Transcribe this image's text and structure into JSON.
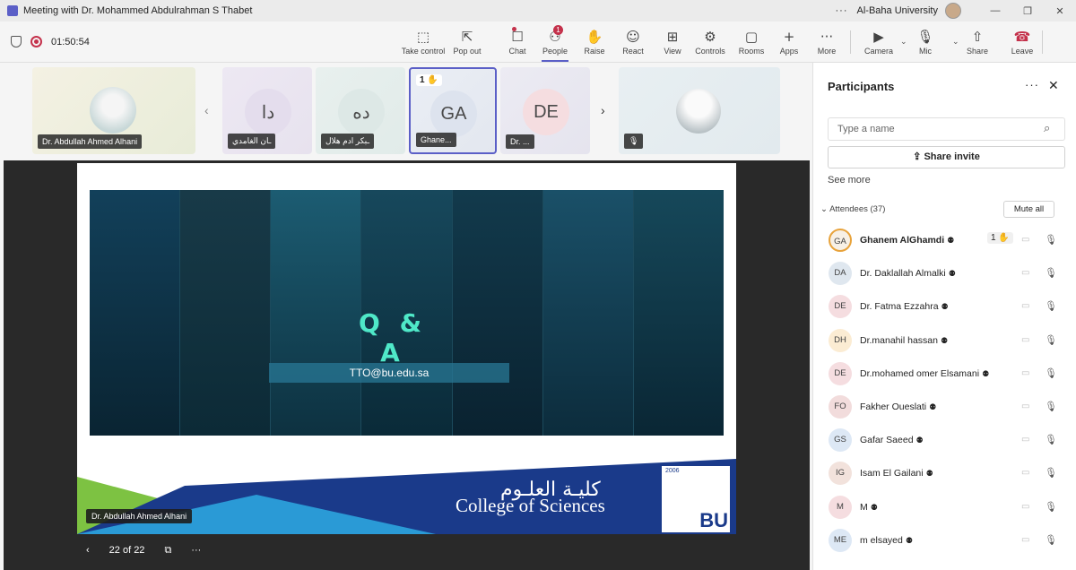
{
  "window": {
    "title": "Meeting with Dr. Mohammed Abdulrahman S Thabet",
    "org": "Al-Baha University"
  },
  "meeting": {
    "timer": "01:50:54"
  },
  "toolbar": {
    "items": [
      {
        "label": "Take control",
        "icon": "⬚"
      },
      {
        "label": "Pop out",
        "icon": "⇱"
      },
      {
        "label": "Chat",
        "icon": "☐"
      },
      {
        "label": "People",
        "icon": "⚇",
        "badge": "1"
      },
      {
        "label": "Raise",
        "icon": "✋"
      },
      {
        "label": "React",
        "icon": "☺"
      },
      {
        "label": "View",
        "icon": "⊞"
      },
      {
        "label": "Controls",
        "icon": "⚙"
      },
      {
        "label": "Rooms",
        "icon": "▢"
      },
      {
        "label": "Apps",
        "icon": "+"
      },
      {
        "label": "More",
        "icon": "···"
      },
      {
        "label": "Camera",
        "icon": "▶"
      },
      {
        "label": "Mic",
        "icon": "🎙"
      },
      {
        "label": "Share",
        "icon": "⇧"
      },
      {
        "label": "Leave",
        "icon": "☎"
      }
    ]
  },
  "strip": {
    "tiles": [
      {
        "name": "Dr. Abdullah Ahmed Alhani"
      },
      {
        "initials": "دا",
        "name": "ـان الغامدي"
      },
      {
        "initials": "ده",
        "name": "ـبكر ادم هلال"
      },
      {
        "initials": "GA",
        "name": "Ghane...",
        "raise": "1 ✋"
      },
      {
        "initials": "DE",
        "name": "Dr. ..."
      },
      {
        "name": ""
      }
    ]
  },
  "slide": {
    "heading": "Q & A",
    "email": "TTO@bu.edu.sa",
    "college_ar": "كليـة العلـوم",
    "college_en": "College of Sciences",
    "logo_year": "2006",
    "logo_text": "BU"
  },
  "stage": {
    "speaker": "Dr. Abdullah Ahmed Alhani",
    "page": "22 of 22"
  },
  "panel": {
    "title": "Participants",
    "search_placeholder": "Type a name",
    "share_invite": "Share invite",
    "see_more": "See more",
    "attendees": "Attendees (37)",
    "mute_all": "Mute all",
    "participants": [
      {
        "initials": "GA",
        "name": "Ghanem AlGhamdi",
        "raise": "1 ✋",
        "bg": "#f7f0e6"
      },
      {
        "initials": "DA",
        "name": "Dr. Daklallah Almalki",
        "bg": "#dfe7ef"
      },
      {
        "initials": "DE",
        "name": "Dr. Fatma Ezzahra",
        "bg": "#f5dde0"
      },
      {
        "initials": "DH",
        "name": "Dr.manahil hassan",
        "bg": "#fbecd3"
      },
      {
        "initials": "DE",
        "name": "Dr.mohamed omer Elsamani",
        "bg": "#f5dde0"
      },
      {
        "initials": "FO",
        "name": "Fakher Oueslati",
        "bg": "#f2dcdc"
      },
      {
        "initials": "GS",
        "name": "Gafar Saeed",
        "bg": "#dde8f5"
      },
      {
        "initials": "IG",
        "name": "Isam El Gailani",
        "bg": "#f2e2dc"
      },
      {
        "initials": "M",
        "name": "M",
        "bg": "#f5dde0"
      },
      {
        "initials": "ME",
        "name": "m elsayed",
        "bg": "#dde8f5"
      }
    ]
  }
}
